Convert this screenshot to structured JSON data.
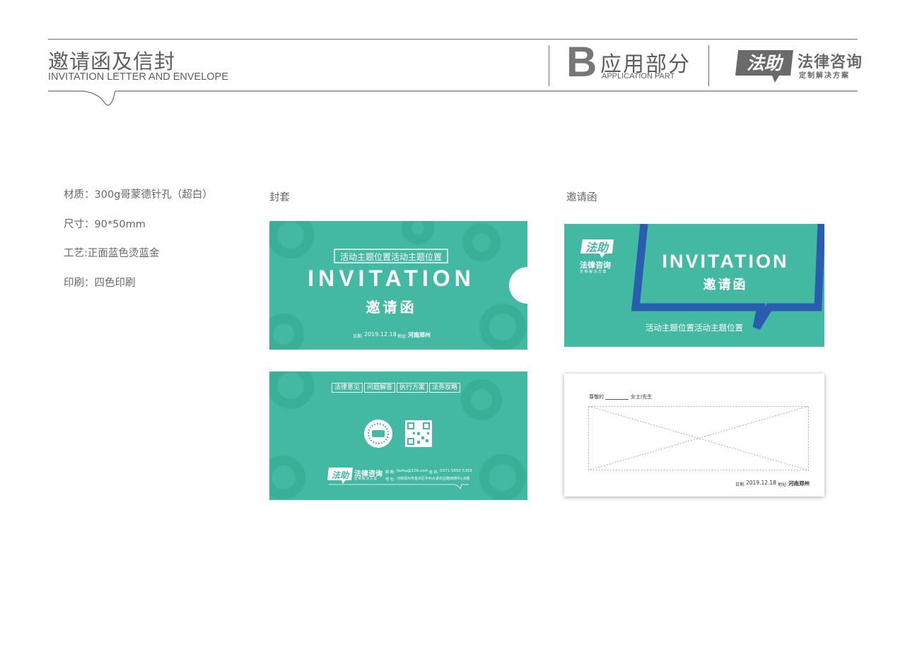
{
  "header": {
    "title_cn": "邀请函及信封",
    "title_en": "INVITATION LETTER AND ENVELOPE",
    "section_letter": "B",
    "section_cn": "应用部分",
    "section_en": "APPLICATION PART",
    "brand_logo_text": "法助",
    "brand_name": "法律咨询",
    "brand_tagline": "定制解决方案"
  },
  "specs": [
    "材质：300g哥蒙德针孔（超白）",
    "尺寸：90*50mm",
    "工艺:正面蓝色烫蓝金",
    "印刷：四色印刷"
  ],
  "sections": {
    "envelope": "封套",
    "invitation": "邀请函"
  },
  "envelope_front": {
    "subtitle": "活动主题位置活动主题位置",
    "title_en": "INVITATION",
    "title_cn": "邀请函",
    "date_label": "日期:",
    "date": "2019.12.18",
    "address_label": "地址:",
    "address": "河南郑州"
  },
  "envelope_back": {
    "tags": [
      "法律意见",
      "问题解答",
      "执行方案",
      "法务攻略"
    ],
    "logo_text": "法助",
    "brand_name": "法律咨询",
    "brand_tagline": "定制解决方案",
    "email_label": "邮 箱:",
    "email": "fazhu@126.com",
    "phone_label": "座 机:",
    "phone": "0371-5555 5353",
    "address_label": "地 址:",
    "address": "河南郑州市金水区中州大道农业路西侧中心6楼"
  },
  "invitation_front": {
    "logo_text": "法助",
    "brand_name": "法律咨询",
    "brand_tagline": "定制解决方案",
    "title_en": "INVITATION",
    "title_cn": "邀请函",
    "subtitle": "活动主题位置活动主题位置"
  },
  "invitation_letter": {
    "salutation_prefix": "尊敬的",
    "salutation_suffix": "女士/先生",
    "date_label": "日期:",
    "date": "2019.12.18",
    "address_label": "地址:",
    "address": "河南郑州"
  },
  "colors": {
    "teal": "#43b8a2",
    "teal_dark": "#35a890",
    "blue": "#2a5db0",
    "gray_text": "#5e5e5e"
  }
}
